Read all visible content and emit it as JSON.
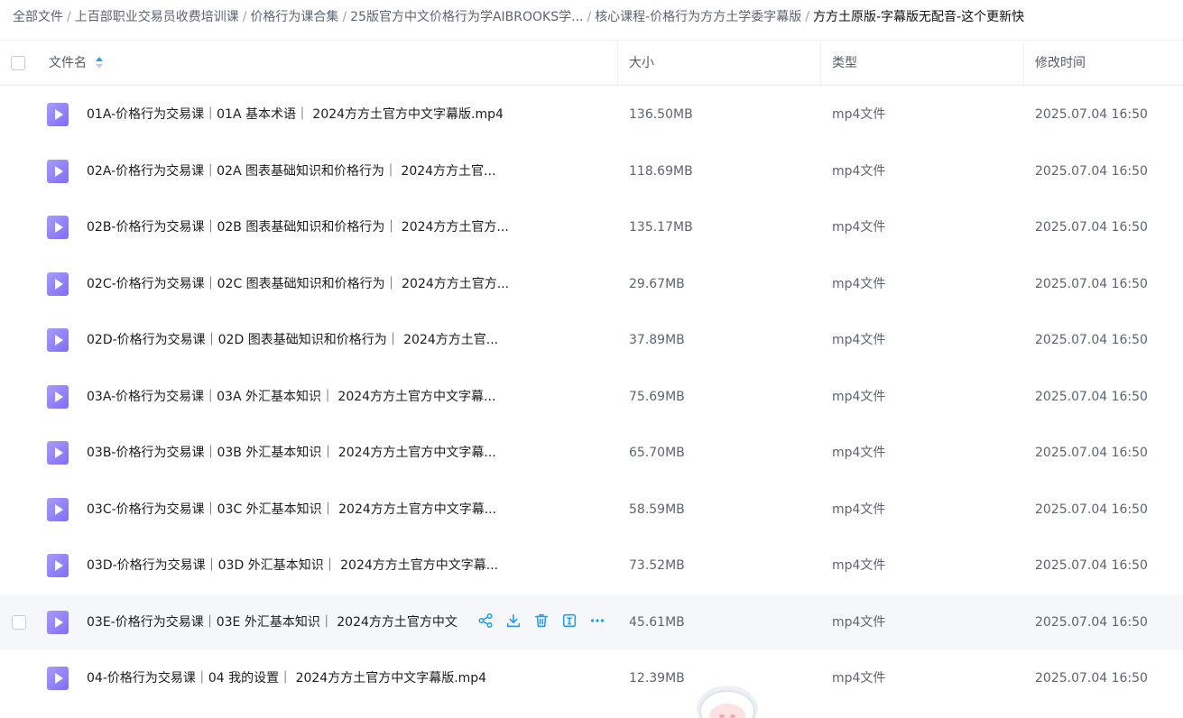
{
  "breadcrumb": [
    "全部文件",
    "上百部职业交易员收费培训课",
    "价格行为课合集",
    "25版官方中文价格行为学AIBROOKS学...",
    "核心课程-价格行为方方土学委字幕版",
    "方方土原版-字幕版无配音-这个更新快"
  ],
  "breadcrumb_separator": "/",
  "columns": {
    "name": "文件名",
    "size": "大小",
    "type": "类型",
    "modified": "修改时间"
  },
  "rows": [
    {
      "name": "01A-价格行为交易课｜01A 基本术语｜ 2024方方土官方中文字幕版.mp4",
      "size": "136.50MB",
      "type": "mp4文件",
      "modified": "2025.07.04 16:50"
    },
    {
      "name": "02A-价格行为交易课｜02A 图表基础知识和价格行为｜ 2024方方土官...",
      "size": "118.69MB",
      "type": "mp4文件",
      "modified": "2025.07.04 16:50"
    },
    {
      "name": "02B-价格行为交易课｜02B 图表基础知识和价格行为｜ 2024方方土官方...",
      "size": "135.17MB",
      "type": "mp4文件",
      "modified": "2025.07.04 16:50"
    },
    {
      "name": "02C-价格行为交易课｜02C 图表基础知识和价格行为｜ 2024方方土官方...",
      "size": "29.67MB",
      "type": "mp4文件",
      "modified": "2025.07.04 16:50"
    },
    {
      "name": "02D-价格行为交易课｜02D 图表基础知识和价格行为｜ 2024方方土官...",
      "size": "37.89MB",
      "type": "mp4文件",
      "modified": "2025.07.04 16:50"
    },
    {
      "name": "03A-价格行为交易课｜03A 外汇基本知识｜ 2024方方土官方中文字幕...",
      "size": "75.69MB",
      "type": "mp4文件",
      "modified": "2025.07.04 16:50"
    },
    {
      "name": "03B-价格行为交易课｜03B 外汇基本知识｜ 2024方方土官方中文字幕...",
      "size": "65.70MB",
      "type": "mp4文件",
      "modified": "2025.07.04 16:50"
    },
    {
      "name": "03C-价格行为交易课｜03C 外汇基本知识｜ 2024方方土官方中文字幕...",
      "size": "58.59MB",
      "type": "mp4文件",
      "modified": "2025.07.04 16:50"
    },
    {
      "name": "03D-价格行为交易课｜03D 外汇基本知识｜ 2024方方土官方中文字幕...",
      "size": "73.52MB",
      "type": "mp4文件",
      "modified": "2025.07.04 16:50"
    },
    {
      "name": "03E-价格行为交易课｜03E 外汇基本知识｜ 2024方方土官方中文",
      "size": "45.61MB",
      "type": "mp4文件",
      "modified": "2025.07.04 16:50"
    },
    {
      "name": "04-价格行为交易课｜04 我的设置｜ 2024方方土官方中文字幕版.mp4",
      "size": "12.39MB",
      "type": "mp4文件",
      "modified": "2025.07.04 16:50"
    }
  ],
  "hovered_row": 9,
  "row_actions": [
    "share-icon",
    "download-icon",
    "delete-icon",
    "rename-icon",
    "more-icon"
  ],
  "colors": {
    "accent": "#1e9ff2",
    "file_icon": "#8b7cf8",
    "hover_row": "#f6f7fb"
  }
}
